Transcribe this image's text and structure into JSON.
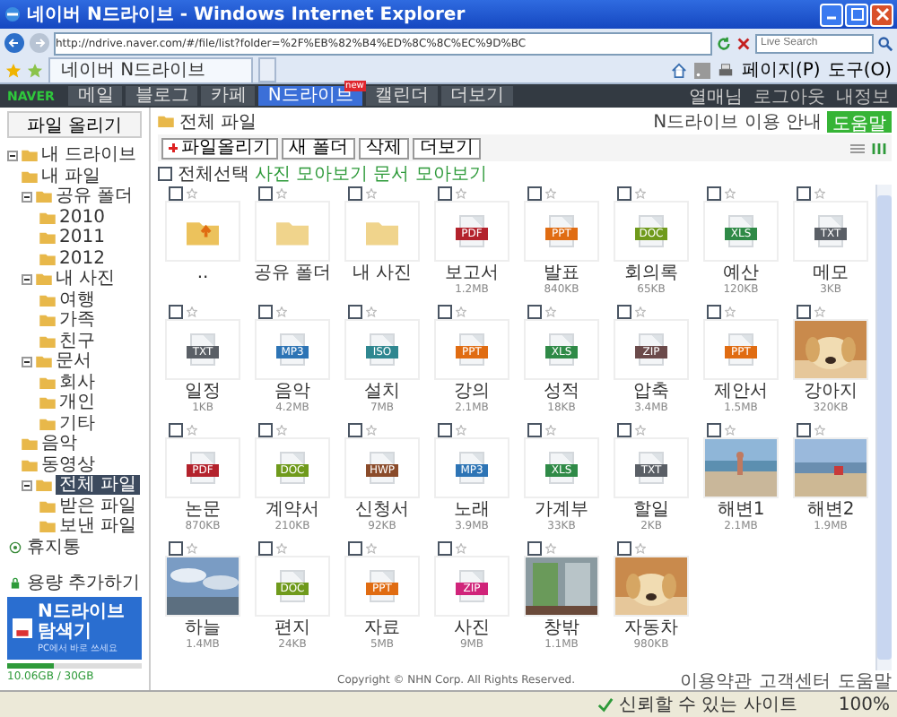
{
  "window": {
    "title": "네이버 N드라이브 - Windows Internet Explorer"
  },
  "address_bar": {
    "url": "http://ndrive.naver.com/#/file/list?folder=%2F%EB%82%B4%ED%8C%8C%EC%9D%BC"
  },
  "search": {
    "placeholder": "Live Search"
  },
  "browser_tab": {
    "title": "네이버 N드라이브"
  },
  "command_bar": [
    "페이지(P)",
    "도구(O)"
  ],
  "naver_bar": {
    "logo": "NAVER",
    "tabs": [
      {
        "label": "메일",
        "selected": false
      },
      {
        "label": "블로그",
        "selected": false
      },
      {
        "label": "카페",
        "selected": false
      },
      {
        "label": "N드라이브",
        "selected": true,
        "badge": "new"
      },
      {
        "label": "캘린더",
        "selected": false
      },
      {
        "label": "더보기",
        "selected": false
      }
    ],
    "user": "열매님",
    "links": [
      "로그아웃",
      "내정보"
    ]
  },
  "sidebar": {
    "upload_button": "파일 올리기",
    "tree": [
      {
        "label": "내 드라이브",
        "selected": false,
        "expanded": true,
        "children": [
          {
            "label": "내 파일",
            "selected": false
          },
          {
            "label": "공유 폴더",
            "selected": false,
            "expanded": true,
            "children": [
              {
                "label": "2010",
                "selected": false
              },
              {
                "label": "2011",
                "selected": false
              },
              {
                "label": "2012",
                "selected": false
              }
            ]
          },
          {
            "label": "내 사진",
            "selected": false,
            "expanded": true,
            "children": [
              {
                "label": "여행",
                "selected": false
              },
              {
                "label": "가족",
                "selected": false
              },
              {
                "label": "친구",
                "selected": false
              }
            ]
          },
          {
            "label": "문서",
            "selected": false,
            "expanded": true,
            "children": [
              {
                "label": "회사",
                "selected": false
              },
              {
                "label": "개인",
                "selected": false
              },
              {
                "label": "기타",
                "selected": false
              }
            ]
          },
          {
            "label": "음악",
            "selected": false
          },
          {
            "label": "동영상",
            "selected": false
          },
          {
            "label": "전체 파일",
            "selected": true,
            "expanded": true,
            "children": [
              {
                "label": "받은 파일",
                "selected": false
              },
              {
                "label": "보낸 파일",
                "selected": false
              }
            ]
          }
        ]
      }
    ],
    "trash": "휴지통",
    "notice": "용량 추가하기",
    "promo": {
      "title": "N드라이브 탐색기",
      "subtitle": "PC에서 바로 쓰세요"
    },
    "storage": {
      "level": 0.34,
      "reading": "10.06GB / 30GB"
    }
  },
  "main": {
    "breadcrumb": "전체 파일",
    "guide": "N드라이브 이용 안내",
    "help_button": "도움말",
    "toolbar": [
      "파일올리기",
      "새 폴더",
      "삭제",
      "더보기"
    ],
    "select_all": "전체선택",
    "select_all_checked": false,
    "links": [
      "사진 모아보기",
      "문서 모아보기"
    ],
    "items": [
      {
        "kind": "folder-up",
        "name": "..",
        "checked": false
      },
      {
        "kind": "folder",
        "name": "공유 폴더",
        "checked": false
      },
      {
        "kind": "folder",
        "name": "내 사진",
        "checked": false
      },
      {
        "kind": "file",
        "name": "보고서",
        "ext": "PDF",
        "color": "#b3222c",
        "size": "1.2MB",
        "checked": false
      },
      {
        "kind": "file",
        "name": "발표",
        "ext": "PPT",
        "color": "#e06c12",
        "size": "840KB",
        "checked": false
      },
      {
        "kind": "file",
        "name": "회의록",
        "ext": "DOC",
        "color": "#6f9a1c",
        "size": "65KB",
        "checked": false
      },
      {
        "kind": "file",
        "name": "예산",
        "ext": "XLS",
        "color": "#2f8a47",
        "size": "120KB",
        "checked": false
      },
      {
        "kind": "file",
        "name": "메모",
        "ext": "TXT",
        "color": "#5a5f66",
        "size": "3KB",
        "checked": false
      },
      {
        "kind": "file",
        "name": "일정",
        "ext": "TXT",
        "color": "#5a5f66",
        "size": "1KB",
        "checked": false
      },
      {
        "kind": "file",
        "name": "음악",
        "ext": "MP3",
        "color": "#2d74b5",
        "size": "4.2MB",
        "checked": false
      },
      {
        "kind": "file",
        "name": "설치",
        "ext": "ISO",
        "color": "#2f8790",
        "size": "7MB",
        "checked": false
      },
      {
        "kind": "file",
        "name": "강의",
        "ext": "PPT",
        "color": "#e06c12",
        "size": "2.1MB",
        "checked": false
      },
      {
        "kind": "file",
        "name": "성적",
        "ext": "XLS",
        "color": "#2f8a47",
        "size": "18KB",
        "checked": false
      },
      {
        "kind": "file",
        "name": "압축",
        "ext": "ZIP",
        "color": "#6b4a4a",
        "size": "3.4MB",
        "checked": false
      },
      {
        "kind": "file",
        "name": "제안서",
        "ext": "PPT",
        "color": "#e06c12",
        "size": "1.5MB",
        "checked": false
      },
      {
        "kind": "picture",
        "name": "강아지",
        "size": "320KB",
        "checked": false
      },
      {
        "kind": "file",
        "name": "논문",
        "ext": "PDF",
        "color": "#b3222c",
        "size": "870KB",
        "checked": false
      },
      {
        "kind": "file",
        "name": "계약서",
        "ext": "DOC",
        "color": "#6f9a1c",
        "size": "210KB",
        "checked": false
      },
      {
        "kind": "file",
        "name": "신청서",
        "ext": "HWP",
        "color": "#8a4b2a",
        "size": "92KB",
        "checked": false
      },
      {
        "kind": "file",
        "name": "노래",
        "ext": "MP3",
        "color": "#2d74b5",
        "size": "3.9MB",
        "checked": false
      },
      {
        "kind": "file",
        "name": "가계부",
        "ext": "XLS",
        "color": "#2f8a47",
        "size": "33KB",
        "checked": false
      },
      {
        "kind": "file",
        "name": "할일",
        "ext": "TXT",
        "color": "#5a5f66",
        "size": "2KB",
        "checked": false
      },
      {
        "kind": "picture",
        "name": "해변1",
        "size": "2.1MB",
        "checked": false
      },
      {
        "kind": "picture",
        "name": "해변2",
        "size": "1.9MB",
        "checked": false
      },
      {
        "kind": "picture",
        "name": "하늘",
        "size": "1.4MB",
        "checked": false
      },
      {
        "kind": "file",
        "name": "편지",
        "ext": "DOC",
        "color": "#6f9a1c",
        "size": "24KB",
        "checked": false
      },
      {
        "kind": "file",
        "name": "자료",
        "ext": "PPT",
        "color": "#e06c12",
        "size": "5MB",
        "checked": false
      },
      {
        "kind": "file",
        "name": "사진",
        "ext": "ZIP",
        "color": "#d0247a",
        "size": "9MB",
        "checked": false
      },
      {
        "kind": "picture",
        "name": "창밖",
        "size": "1.1MB",
        "checked": false
      },
      {
        "kind": "picture",
        "name": "자동차",
        "size": "980KB",
        "checked": false
      }
    ],
    "footer": "Copyright © NHN Corp. All Rights Reserved.",
    "footer_links": [
      "이용약관",
      "고객센터",
      "도움말"
    ]
  },
  "status_bar": {
    "zone": "신뢰할 수 있는 사이트",
    "zoom": "100%"
  }
}
